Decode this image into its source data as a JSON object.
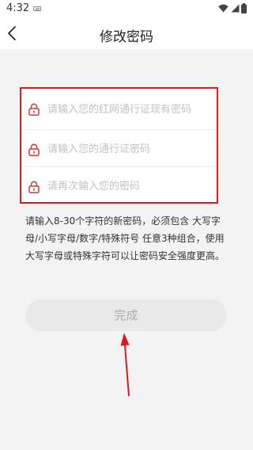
{
  "status_bar": {
    "time": "4:32"
  },
  "header": {
    "title": "修改密码"
  },
  "form": {
    "fields": [
      {
        "placeholder": "请输入您的红网通行证现有密码",
        "value": ""
      },
      {
        "placeholder": "请输入您的通行证密码",
        "value": ""
      },
      {
        "placeholder": "请再次输入您的密码",
        "value": ""
      }
    ]
  },
  "hint": "请输入8-30个字符的新密码，必须包含 大写字母/小写字母/数字/特殊符号 任意3种组合，使用大写字母或特殊字符可以让密码安全强度更高。",
  "actions": {
    "done_label": "完成"
  },
  "colors": {
    "highlight_red": "#e0181f",
    "lock_red": "#d33a3a",
    "button_bg": "#e9e9e9",
    "button_text": "#a9a9a9"
  },
  "icons": [
    "keyboard-icon",
    "wifi-icon",
    "signal-icon",
    "battery-icon",
    "back-arrow-icon",
    "lock-icon"
  ]
}
